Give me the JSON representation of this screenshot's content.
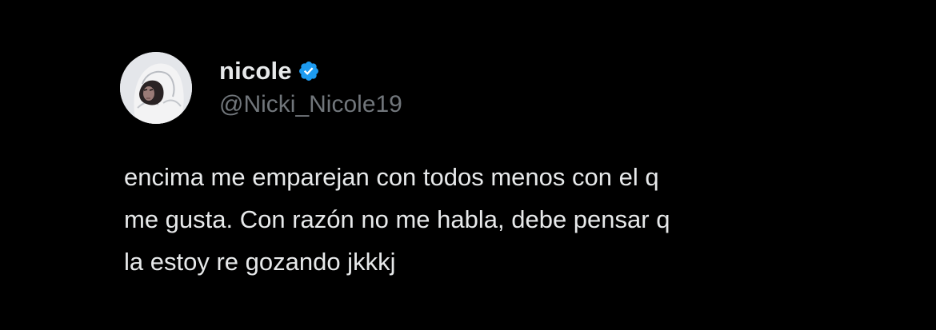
{
  "tweet": {
    "author": {
      "display_name": "nicole",
      "handle": "@Nicki_Nicole19",
      "verified": true,
      "avatar": "profile-photo"
    },
    "text_lines": [
      "encima me emparejan con todos menos con el q",
      "me gusta. Con razón no me habla, debe pensar q",
      "la estoy re gozando jkkkj"
    ]
  },
  "colors": {
    "background": "#000000",
    "primary_text": "#e7e9ea",
    "secondary_text": "#71767b",
    "verified_badge": "#1d9bf0"
  },
  "icons": {
    "verified": "verified-badge-icon"
  }
}
